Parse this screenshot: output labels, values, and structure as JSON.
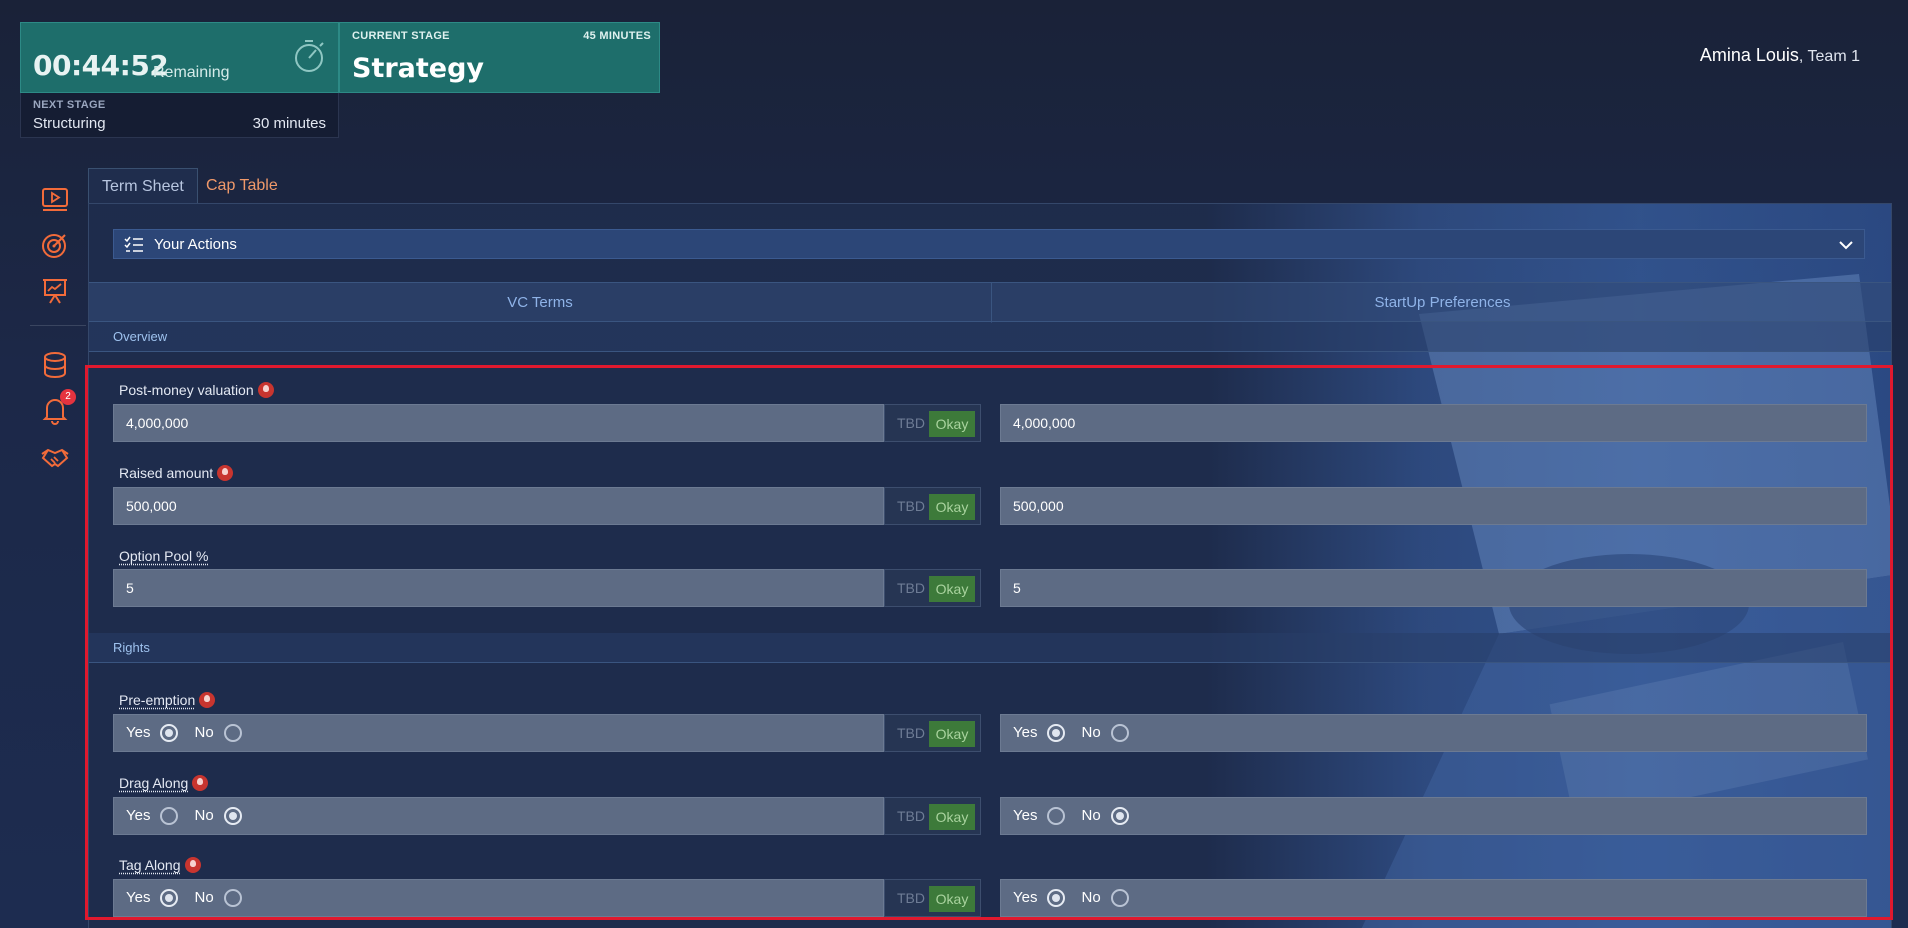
{
  "timer": {
    "time": "00:44:52",
    "remaining_label": "Remaining",
    "next_stage_label": "NEXT STAGE",
    "next_stage_name": "Structuring",
    "next_stage_minutes": "30 minutes"
  },
  "stage": {
    "label": "CURRENT STAGE",
    "minutes": "45 MINUTES",
    "name": "Strategy"
  },
  "user": {
    "name": "Amina Louis",
    "team": ", Team 1"
  },
  "nav": {
    "icons": [
      "video-play-icon",
      "target-icon",
      "presentation-icon",
      "database-icon",
      "bell-icon",
      "handshake-icon"
    ],
    "notification_count": "2",
    "accent_color": "#f26b3a"
  },
  "tabs": {
    "term_sheet": "Term Sheet",
    "cap_table": "Cap Table"
  },
  "actions": {
    "label": "Your Actions"
  },
  "subtabs": {
    "vc": "VC Terms",
    "startup": "StartUp Preferences"
  },
  "sections": {
    "overview": "Overview",
    "rights": "Rights"
  },
  "common": {
    "tbd": "TBD",
    "okay": "Okay",
    "yes": "Yes",
    "no": "No"
  },
  "fields": {
    "post_money": {
      "label": "Post-money valuation",
      "vc_value": "4,000,000",
      "startup_value": "4,000,000"
    },
    "raised": {
      "label": "Raised amount",
      "vc_value": "500,000",
      "startup_value": "500,000"
    },
    "option_pool": {
      "label": "Option Pool %",
      "vc_value": "5",
      "startup_value": "5"
    },
    "pre_emption": {
      "label": "Pre-emption",
      "vc_value": "Yes",
      "startup_value": "Yes"
    },
    "drag_along": {
      "label": "Drag Along",
      "vc_value": "No",
      "startup_value": "No"
    },
    "tag_along": {
      "label": "Tag Along",
      "vc_value": "Yes",
      "startup_value": "Yes"
    }
  },
  "colors": {
    "stage_teal": "#1e6e6b",
    "okay_green": "#3d7a3a",
    "highlight_red": "#e0192e",
    "link_orange": "#f0996a"
  }
}
